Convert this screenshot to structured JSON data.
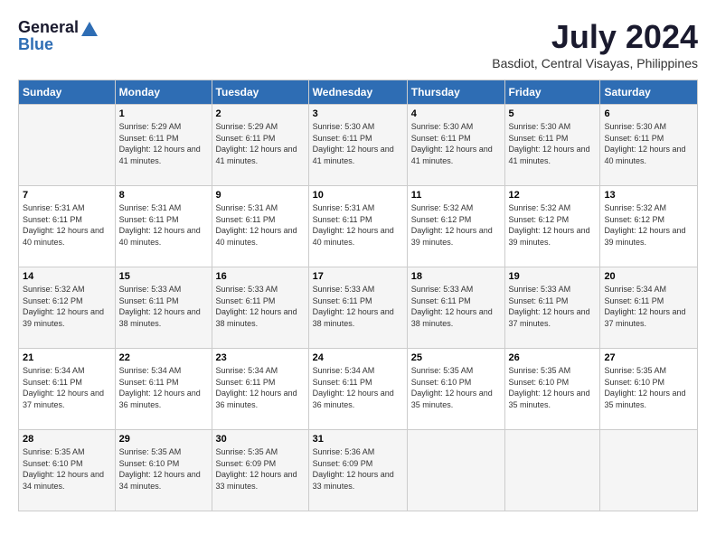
{
  "header": {
    "logo_general": "General",
    "logo_blue": "Blue",
    "month_year": "July 2024",
    "location": "Basdiot, Central Visayas, Philippines"
  },
  "weekdays": [
    "Sunday",
    "Monday",
    "Tuesday",
    "Wednesday",
    "Thursday",
    "Friday",
    "Saturday"
  ],
  "weeks": [
    [
      {
        "day": "",
        "sunrise": "",
        "sunset": "",
        "daylight": ""
      },
      {
        "day": "1",
        "sunrise": "Sunrise: 5:29 AM",
        "sunset": "Sunset: 6:11 PM",
        "daylight": "Daylight: 12 hours and 41 minutes."
      },
      {
        "day": "2",
        "sunrise": "Sunrise: 5:29 AM",
        "sunset": "Sunset: 6:11 PM",
        "daylight": "Daylight: 12 hours and 41 minutes."
      },
      {
        "day": "3",
        "sunrise": "Sunrise: 5:30 AM",
        "sunset": "Sunset: 6:11 PM",
        "daylight": "Daylight: 12 hours and 41 minutes."
      },
      {
        "day": "4",
        "sunrise": "Sunrise: 5:30 AM",
        "sunset": "Sunset: 6:11 PM",
        "daylight": "Daylight: 12 hours and 41 minutes."
      },
      {
        "day": "5",
        "sunrise": "Sunrise: 5:30 AM",
        "sunset": "Sunset: 6:11 PM",
        "daylight": "Daylight: 12 hours and 41 minutes."
      },
      {
        "day": "6",
        "sunrise": "Sunrise: 5:30 AM",
        "sunset": "Sunset: 6:11 PM",
        "daylight": "Daylight: 12 hours and 40 minutes."
      }
    ],
    [
      {
        "day": "7",
        "sunrise": "Sunrise: 5:31 AM",
        "sunset": "Sunset: 6:11 PM",
        "daylight": "Daylight: 12 hours and 40 minutes."
      },
      {
        "day": "8",
        "sunrise": "Sunrise: 5:31 AM",
        "sunset": "Sunset: 6:11 PM",
        "daylight": "Daylight: 12 hours and 40 minutes."
      },
      {
        "day": "9",
        "sunrise": "Sunrise: 5:31 AM",
        "sunset": "Sunset: 6:11 PM",
        "daylight": "Daylight: 12 hours and 40 minutes."
      },
      {
        "day": "10",
        "sunrise": "Sunrise: 5:31 AM",
        "sunset": "Sunset: 6:11 PM",
        "daylight": "Daylight: 12 hours and 40 minutes."
      },
      {
        "day": "11",
        "sunrise": "Sunrise: 5:32 AM",
        "sunset": "Sunset: 6:12 PM",
        "daylight": "Daylight: 12 hours and 39 minutes."
      },
      {
        "day": "12",
        "sunrise": "Sunrise: 5:32 AM",
        "sunset": "Sunset: 6:12 PM",
        "daylight": "Daylight: 12 hours and 39 minutes."
      },
      {
        "day": "13",
        "sunrise": "Sunrise: 5:32 AM",
        "sunset": "Sunset: 6:12 PM",
        "daylight": "Daylight: 12 hours and 39 minutes."
      }
    ],
    [
      {
        "day": "14",
        "sunrise": "Sunrise: 5:32 AM",
        "sunset": "Sunset: 6:12 PM",
        "daylight": "Daylight: 12 hours and 39 minutes."
      },
      {
        "day": "15",
        "sunrise": "Sunrise: 5:33 AM",
        "sunset": "Sunset: 6:11 PM",
        "daylight": "Daylight: 12 hours and 38 minutes."
      },
      {
        "day": "16",
        "sunrise": "Sunrise: 5:33 AM",
        "sunset": "Sunset: 6:11 PM",
        "daylight": "Daylight: 12 hours and 38 minutes."
      },
      {
        "day": "17",
        "sunrise": "Sunrise: 5:33 AM",
        "sunset": "Sunset: 6:11 PM",
        "daylight": "Daylight: 12 hours and 38 minutes."
      },
      {
        "day": "18",
        "sunrise": "Sunrise: 5:33 AM",
        "sunset": "Sunset: 6:11 PM",
        "daylight": "Daylight: 12 hours and 38 minutes."
      },
      {
        "day": "19",
        "sunrise": "Sunrise: 5:33 AM",
        "sunset": "Sunset: 6:11 PM",
        "daylight": "Daylight: 12 hours and 37 minutes."
      },
      {
        "day": "20",
        "sunrise": "Sunrise: 5:34 AM",
        "sunset": "Sunset: 6:11 PM",
        "daylight": "Daylight: 12 hours and 37 minutes."
      }
    ],
    [
      {
        "day": "21",
        "sunrise": "Sunrise: 5:34 AM",
        "sunset": "Sunset: 6:11 PM",
        "daylight": "Daylight: 12 hours and 37 minutes."
      },
      {
        "day": "22",
        "sunrise": "Sunrise: 5:34 AM",
        "sunset": "Sunset: 6:11 PM",
        "daylight": "Daylight: 12 hours and 36 minutes."
      },
      {
        "day": "23",
        "sunrise": "Sunrise: 5:34 AM",
        "sunset": "Sunset: 6:11 PM",
        "daylight": "Daylight: 12 hours and 36 minutes."
      },
      {
        "day": "24",
        "sunrise": "Sunrise: 5:34 AM",
        "sunset": "Sunset: 6:11 PM",
        "daylight": "Daylight: 12 hours and 36 minutes."
      },
      {
        "day": "25",
        "sunrise": "Sunrise: 5:35 AM",
        "sunset": "Sunset: 6:10 PM",
        "daylight": "Daylight: 12 hours and 35 minutes."
      },
      {
        "day": "26",
        "sunrise": "Sunrise: 5:35 AM",
        "sunset": "Sunset: 6:10 PM",
        "daylight": "Daylight: 12 hours and 35 minutes."
      },
      {
        "day": "27",
        "sunrise": "Sunrise: 5:35 AM",
        "sunset": "Sunset: 6:10 PM",
        "daylight": "Daylight: 12 hours and 35 minutes."
      }
    ],
    [
      {
        "day": "28",
        "sunrise": "Sunrise: 5:35 AM",
        "sunset": "Sunset: 6:10 PM",
        "daylight": "Daylight: 12 hours and 34 minutes."
      },
      {
        "day": "29",
        "sunrise": "Sunrise: 5:35 AM",
        "sunset": "Sunset: 6:10 PM",
        "daylight": "Daylight: 12 hours and 34 minutes."
      },
      {
        "day": "30",
        "sunrise": "Sunrise: 5:35 AM",
        "sunset": "Sunset: 6:09 PM",
        "daylight": "Daylight: 12 hours and 33 minutes."
      },
      {
        "day": "31",
        "sunrise": "Sunrise: 5:36 AM",
        "sunset": "Sunset: 6:09 PM",
        "daylight": "Daylight: 12 hours and 33 minutes."
      },
      {
        "day": "",
        "sunrise": "",
        "sunset": "",
        "daylight": ""
      },
      {
        "day": "",
        "sunrise": "",
        "sunset": "",
        "daylight": ""
      },
      {
        "day": "",
        "sunrise": "",
        "sunset": "",
        "daylight": ""
      }
    ]
  ]
}
